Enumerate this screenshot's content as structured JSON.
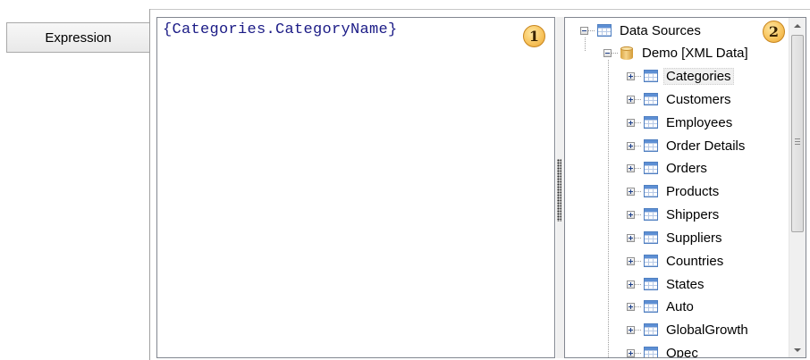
{
  "tab": {
    "label": "Expression"
  },
  "editor": {
    "expression": "{Categories.CategoryName}"
  },
  "badges": {
    "one": "1",
    "two": "2"
  },
  "tree": {
    "root": "Data Sources",
    "datasource": "Demo [XML Data]",
    "tables": [
      "Categories",
      "Customers",
      "Employees",
      "Order Details",
      "Orders",
      "Products",
      "Shippers",
      "Suppliers",
      "Countries",
      "States",
      "Auto",
      "GlobalGrowth",
      "Opec"
    ],
    "selected": "Categories"
  },
  "scrollbar": {
    "up_icon": "arrow-up-icon",
    "down_icon": "arrow-down-icon"
  }
}
